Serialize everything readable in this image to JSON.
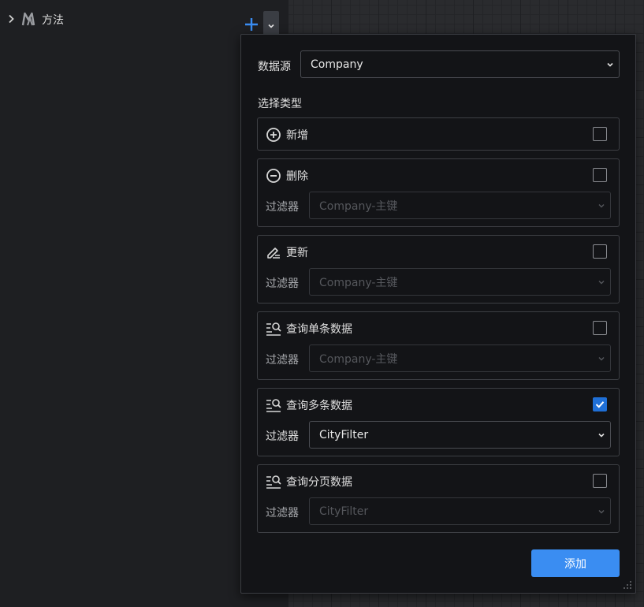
{
  "tree": {
    "label": "方法"
  },
  "panel": {
    "datasource_label": "数据源",
    "datasource_value": "Company",
    "select_type_label": "选择类型",
    "add_button": "添加",
    "cards": [
      {
        "title": "新增",
        "icon": "plus-circle-icon",
        "checked": false
      },
      {
        "title": "删除",
        "icon": "minus-circle-icon",
        "checked": false,
        "filter_label": "过滤器",
        "filter_value": "Company-主键",
        "filter_enabled": false
      },
      {
        "title": "更新",
        "icon": "edit-icon",
        "checked": false,
        "filter_label": "过滤器",
        "filter_value": "Company-主键",
        "filter_enabled": false
      },
      {
        "title": "查询单条数据",
        "icon": "search-list-icon",
        "checked": false,
        "filter_label": "过滤器",
        "filter_value": "Company-主键",
        "filter_enabled": false
      },
      {
        "title": "查询多条数据",
        "icon": "search-list-icon",
        "checked": true,
        "filter_label": "过滤器",
        "filter_value": "CityFilter",
        "filter_enabled": true
      },
      {
        "title": "查询分页数据",
        "icon": "search-list-icon",
        "checked": false,
        "filter_label": "过滤器",
        "filter_value": "CityFilter",
        "filter_enabled": false
      }
    ]
  },
  "colors": {
    "accent": "#3a8df2",
    "checkbox_checked": "#1f6fd6",
    "background": "#131417"
  }
}
